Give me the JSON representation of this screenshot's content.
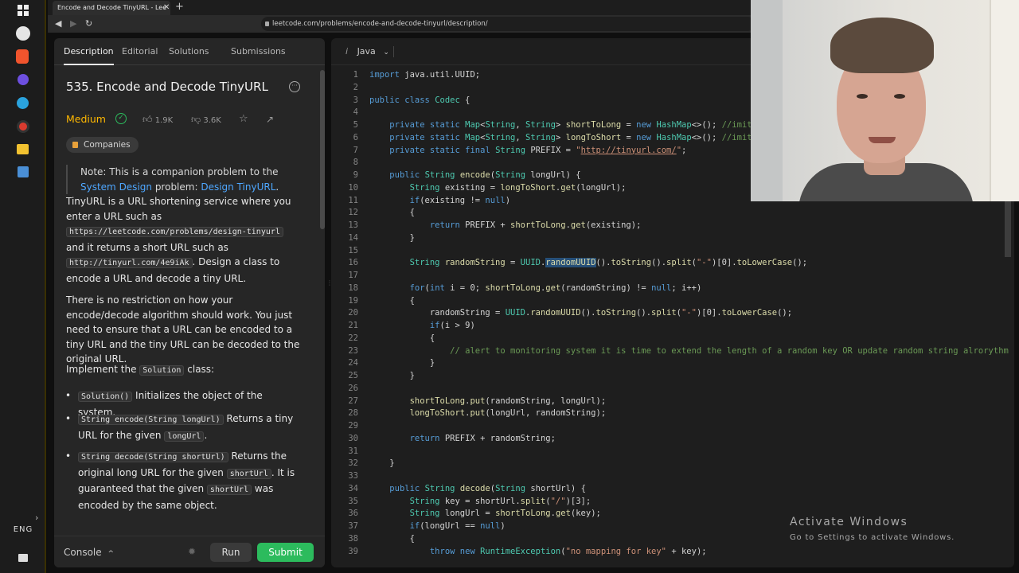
{
  "browser": {
    "tab_title": "Encode and Decode TinyURL - Lee",
    "url": "leetcode.com/problems/encode-and-decode-tinyurl/description/"
  },
  "taskbar": {
    "language": "ENG"
  },
  "description": {
    "tabs": [
      "Description",
      "Editorial",
      "Solutions",
      "Submissions"
    ],
    "title": "535. Encode and Decode TinyURL",
    "difficulty": "Medium",
    "likes": "1.9K",
    "dislikes": "3.6K",
    "companies_label": "Companies",
    "note_prefix": "Note: This is a companion problem to the ",
    "note_link1": "System Design",
    "note_mid": " problem: ",
    "note_link2": "Design TinyURL",
    "note_suffix": ".",
    "p1_a": "TinyURL is a URL shortening service where you enter a URL such as",
    "p1_code1": "https://leetcode.com/problems/design-tinyurl",
    "p1_b": "and it returns a short URL such as",
    "p1_code2": "http://tinyurl.com/4e9iAk",
    "p1_c": ". Design a class to encode a URL and decode a tiny URL.",
    "p2": "There is no restriction on how your encode/decode algorithm should work. You just need to ensure that a URL can be encoded to a tiny URL and the tiny URL can be decoded to the original URL.",
    "p3_a": "Implement the ",
    "p3_code": "Solution",
    "p3_b": " class:",
    "b1_code": "Solution()",
    "b1_text": " Initializes the object of the system.",
    "b2_code": "String encode(String longUrl)",
    "b2_text_a": " Returns a tiny URL for the given ",
    "b2_code2": "longUrl",
    "b2_text_b": ".",
    "b3_code": "String decode(String shortUrl)",
    "b3_text_a": " Returns the original long URL for the given ",
    "b3_code2": "shortUrl",
    "b3_text_b": ". It is guaranteed that the given ",
    "b3_code3": "shortUrl",
    "b3_text_c": " was encoded by the same object."
  },
  "bottom": {
    "console": "Console",
    "run": "Run",
    "submit": "Submit"
  },
  "editor": {
    "language": "Java",
    "lines": [
      {
        "n": "1",
        "html": "<span class='kw'>import</span> java.util.UUID;"
      },
      {
        "n": "2",
        "html": ""
      },
      {
        "n": "3",
        "html": "<span class='kw'>public</span> <span class='kw'>class</span> <span class='ty'>Codec</span> {"
      },
      {
        "n": "4",
        "html": ""
      },
      {
        "n": "5",
        "html": "    <span class='kw'>private</span> <span class='kw'>static</span> <span class='ty'>Map</span>&lt;<span class='ty'>String</span>, <span class='ty'>String</span>&gt; <span class='fn'>shortToLong</span> = <span class='kw'>new</span> <span class='ty'>HashMap</span>&lt;&gt;(); <span class='cm'>//imita</span>"
      },
      {
        "n": "6",
        "html": "    <span class='kw'>private</span> <span class='kw'>static</span> <span class='ty'>Map</span>&lt;<span class='ty'>String</span>, <span class='ty'>String</span>&gt; <span class='fn'>longToShort</span> = <span class='kw'>new</span> <span class='ty'>HashMap</span>&lt;&gt;(); <span class='cm'>//imita</span>"
      },
      {
        "n": "7",
        "html": "    <span class='kw'>private</span> <span class='kw'>static</span> <span class='kw'>final</span> <span class='ty'>String</span> PREFIX = <span class='st'>\"<u>http://tinyurl.com/</u>\"</span>;"
      },
      {
        "n": "8",
        "html": ""
      },
      {
        "n": "9",
        "html": "    <span class='kw'>public</span> <span class='ty'>String</span> <span class='fn'>encode</span>(<span class='ty'>String</span> longUrl) {"
      },
      {
        "n": "10",
        "html": "        <span class='ty'>String</span> existing = <span class='fn'>longToShort</span>.<span class='fn'>get</span>(longUrl);"
      },
      {
        "n": "11",
        "html": "        <span class='kw'>if</span>(existing != <span class='kw'>null</span>)"
      },
      {
        "n": "12",
        "html": "        {"
      },
      {
        "n": "13",
        "html": "            <span class='kw'>return</span> PREFIX + <span class='fn'>shortToLong</span>.<span class='fn'>get</span>(existing);"
      },
      {
        "n": "14",
        "html": "        }"
      },
      {
        "n": "15",
        "html": ""
      },
      {
        "n": "16",
        "html": "        <span class='ty'>String</span> <span class='fn'>randomString</span> = <span class='ty'>UUID</span>.<span class='fn hl'>randomUUID</span>().<span class='fn'>toString</span>().<span class='fn'>split</span>(<span class='st'>\"-\"</span>)[0].<span class='fn'>toLowerCase</span>();"
      },
      {
        "n": "17",
        "html": ""
      },
      {
        "n": "18",
        "html": "        <span class='kw'>for</span>(<span class='kw'>int</span> i = 0; <span class='fn'>shortToLong</span>.<span class='fn'>get</span>(randomString) != <span class='kw'>null</span>; i++)"
      },
      {
        "n": "19",
        "html": "        {"
      },
      {
        "n": "20",
        "html": "            randomString = <span class='ty'>UUID</span>.<span class='fn'>randomUUID</span>().<span class='fn'>toString</span>().<span class='fn'>split</span>(<span class='st'>\"-\"</span>)[0].<span class='fn'>toLowerCase</span>();"
      },
      {
        "n": "21",
        "html": "            <span class='kw'>if</span>(i &gt; 9)"
      },
      {
        "n": "22",
        "html": "            {"
      },
      {
        "n": "23",
        "html": "                <span class='cm'>// alert to monitoring system it is time to extend the length of a random key OR update random string alrorythm</span>"
      },
      {
        "n": "24",
        "html": "            }"
      },
      {
        "n": "25",
        "html": "        }"
      },
      {
        "n": "26",
        "html": ""
      },
      {
        "n": "27",
        "html": "        <span class='fn'>shortToLong</span>.<span class='fn'>put</span>(randomString, longUrl);"
      },
      {
        "n": "28",
        "html": "        <span class='fn'>longToShort</span>.<span class='fn'>put</span>(longUrl, randomString);"
      },
      {
        "n": "29",
        "html": ""
      },
      {
        "n": "30",
        "html": "        <span class='kw'>return</span> PREFIX + randomString;"
      },
      {
        "n": "31",
        "html": ""
      },
      {
        "n": "32",
        "html": "    }"
      },
      {
        "n": "33",
        "html": ""
      },
      {
        "n": "34",
        "html": "    <span class='kw'>public</span> <span class='ty'>String</span> <span class='fn'>decode</span>(<span class='ty'>String</span> shortUrl) {"
      },
      {
        "n": "35",
        "html": "        <span class='ty'>String</span> key = shortUrl.<span class='fn'>split</span>(<span class='st'>\"/\"</span>)[3];"
      },
      {
        "n": "36",
        "html": "        <span class='ty'>String</span> longUrl = <span class='fn'>shortToLong</span>.<span class='fn'>get</span>(key);"
      },
      {
        "n": "37",
        "html": "        <span class='kw'>if</span>(longUrl == <span class='kw'>null</span>)"
      },
      {
        "n": "38",
        "html": "        {"
      },
      {
        "n": "39",
        "html": "            <span class='kw'>throw</span> <span class='kw'>new</span> <span class='ty'>RuntimeException</span>(<span class='st'>\"no mapping for key\"</span> + key);"
      }
    ]
  },
  "watermark": {
    "line1": "Activate Windows",
    "line2": "Go to Settings to activate Windows."
  },
  "colors": {
    "accent_green": "#2cbb5d",
    "difficulty_medium": "#ffb800",
    "link_blue": "#4ea7ff"
  }
}
